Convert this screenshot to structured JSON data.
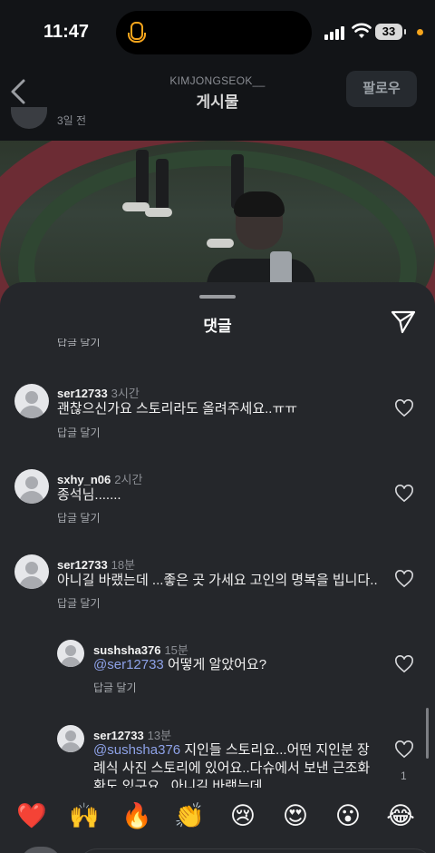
{
  "status_bar": {
    "time": "11:47",
    "battery": "33"
  },
  "header": {
    "username": "KIMJONGSEOK__",
    "title": "게시물",
    "follow_label": "팔로우",
    "post_date": "3일 전"
  },
  "sheet": {
    "title": "댓글",
    "cut_text": "답글 달기"
  },
  "comments": [
    {
      "user": "ser12733",
      "time": "3시간",
      "text": "괜찮으신가요 스토리라도 올려주세요..ㅠㅠ",
      "reply": "답글 달기"
    },
    {
      "user": "sxhy_n06",
      "time": "2시간",
      "text": "종석님.......",
      "reply": "답글 달기"
    },
    {
      "user": "ser12733",
      "time": "18분",
      "text": "아니길 바랬는데 ...좋은 곳 가세요 고인의 명복을 빕니다..",
      "reply": "답글 달기"
    },
    {
      "user": "sushsha376",
      "time": "15분",
      "mention": "@ser12733",
      "text": " 어떻게 알았어요?",
      "reply": "답글 달기"
    },
    {
      "user": "ser12733",
      "time": "13분",
      "mention": "@sushsha376",
      "text": " 지인들 스토리요...어떤 지인분 장례식 사진 스토리에 있어요..다슈에서 보낸 근조화환도 있구요.. 아니길 바랬는데",
      "likes": "1"
    }
  ],
  "emoji_bar": [
    "❤️",
    "🙌",
    "🔥",
    "👏",
    "😢",
    "😍",
    "😮",
    "😂"
  ]
}
